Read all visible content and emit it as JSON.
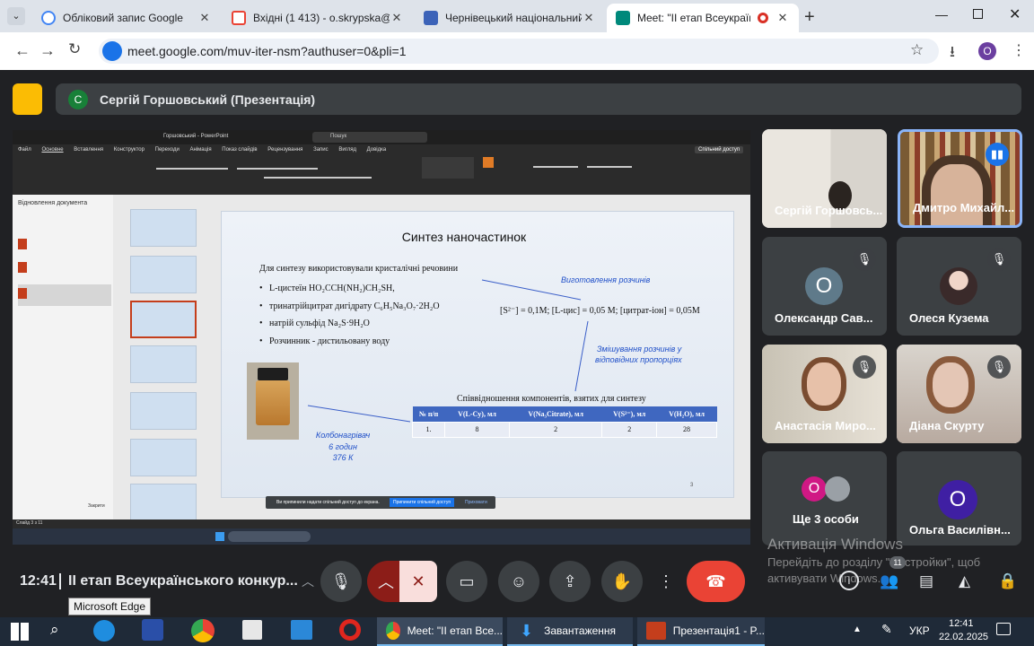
{
  "browser": {
    "tabs": [
      {
        "title": "Обліковий запис Google",
        "active": false
      },
      {
        "title": "Вхідні (1 413) - o.skrypska@chnu.edu.ua",
        "active": false
      },
      {
        "title": "Чернівецький національний у",
        "active": false
      },
      {
        "title": "Meet: \"ІІ етап Всеукраїнськ",
        "active": true
      }
    ],
    "url": "meet.google.com/muv-iter-nsm?authuser=0&pli=1",
    "profile_initial": "O"
  },
  "meet": {
    "presenter_initial": "С",
    "presenter_label": "Сергій Горшовський (Презентація)",
    "meeting_time": "12:41",
    "meeting_title": "ІІ етап Всеукраїнського конкур...",
    "participants": [
      {
        "name": "Сергій Горшовсь...",
        "type": "video"
      },
      {
        "name": "Дмитро Михайл...",
        "type": "video"
      },
      {
        "name": "Олександр Сав...",
        "initial": "О",
        "type": "avatar"
      },
      {
        "name": "Олеся Кузема",
        "type": "photo"
      },
      {
        "name": "Анастасія Миро...",
        "type": "video"
      },
      {
        "name": "Діана Скурту",
        "type": "video"
      },
      {
        "name": "Ще 3 особи",
        "initial": "О",
        "type": "more"
      },
      {
        "name": "Ольга Васил­івн...",
        "initial": "О",
        "type": "avatar"
      }
    ],
    "participants_badge": "11",
    "tooltip": "Microsoft Edge",
    "activation_title": "Активація Windows",
    "activation_line1": "Перейдіть до розділу \"Настройки\", щоб",
    "activation_line2": "активувати Windows."
  },
  "slide": {
    "title": "Синтез наночастинок",
    "intro": "Для синтезу використовували кристалічні речовини",
    "bullets": [
      "L-цистеїн HO₂CCH(NH₂)CH₂SH,",
      "тринатрійцитрат дигідрату C₆H₅Na₃O₇·2H₂O",
      "натрій сульфід Na₂S·9H₂O",
      "Розчинник - дистильовану воду"
    ],
    "note_prep": "Виготовлення розчинів",
    "concentrations": "[S²⁻] = 0,1M; [L-цис] = 0,05 M; [цитрат-іон] = 0,05M",
    "note_mix_1": "Змішування розчинів у",
    "note_mix_2": "відповідних пропорціях",
    "note_heat_1": "Колбонагрівач",
    "note_heat_2": "6 годин",
    "note_heat_3": "376 К",
    "table_caption": "Співвідношення компонентів, взятих для синтезу",
    "table_headers": [
      "№ п/п",
      "V(L-Cy), мл",
      "V(Na₃Citrate), мл",
      "V(S²⁻), мл",
      "V(H₂O), мл"
    ],
    "table_row": [
      "1.",
      "8",
      "2",
      "2",
      "28"
    ],
    "page_number": "3"
  },
  "ppt": {
    "title": "Горшовський - PowerPoint",
    "search": "Пошук",
    "share": "Спільний доступ",
    "menu": [
      "Файл",
      "Основне",
      "Вставлення",
      "Конструктор",
      "Переходи",
      "Анімація",
      "Показ слайдів",
      "Рецензування",
      "Запис",
      "Вигляд",
      "Довідка"
    ],
    "recovery_title": "Відновлення документа",
    "notification": "Ви припинили надати спільний доступ до екрана.",
    "notification_btn": "Припинити спільний доступ",
    "notification_btn2": "Приховати",
    "status_slide": "Слайд 3 з 11",
    "close_btn": "Закрити"
  },
  "taskbar": {
    "items": [
      "Meet: \"ІІ етап Все...",
      "Завантаження",
      "Презентація1 - P..."
    ],
    "lang": "УКР",
    "time": "12:41",
    "date": "22.02.2025"
  }
}
